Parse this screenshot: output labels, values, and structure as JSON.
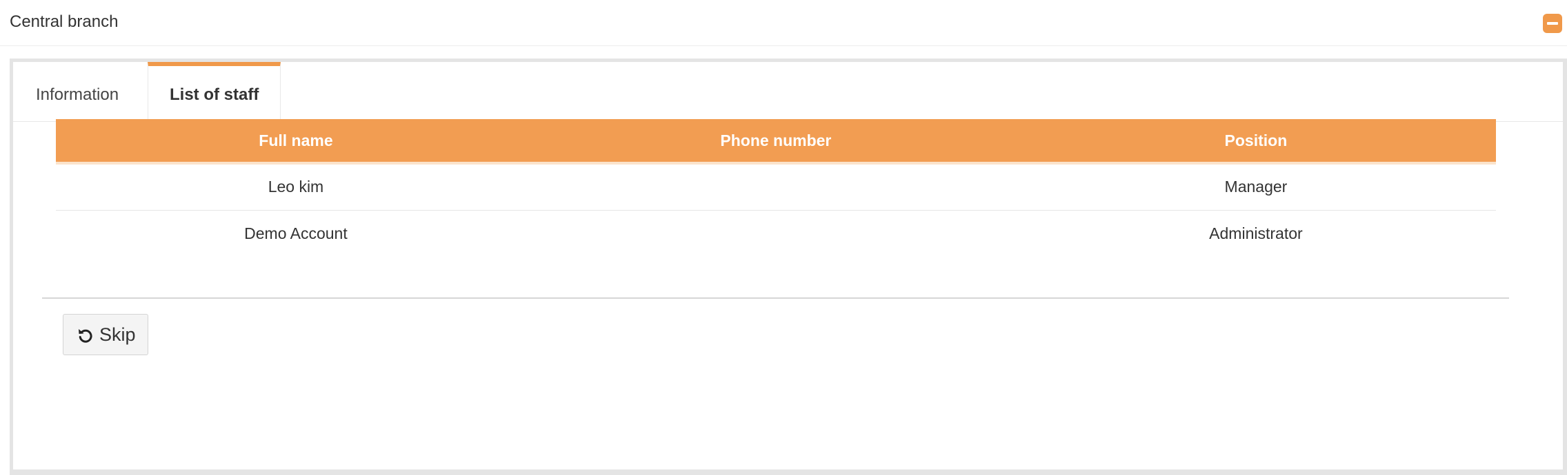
{
  "header": {
    "title": "Central branch",
    "collapse_icon": "minus-square-icon",
    "accent_color": "#f0994a"
  },
  "tabs": [
    {
      "label": "Information",
      "active": false
    },
    {
      "label": "List of staff",
      "active": true
    }
  ],
  "staff_table": {
    "columns": [
      "Full name",
      "Phone number",
      "Position"
    ],
    "rows": [
      {
        "full_name": "Leo kim",
        "phone_number": "",
        "position": "Manager"
      },
      {
        "full_name": "Demo Account",
        "phone_number": "",
        "position": "Administrator"
      }
    ],
    "header_color": "#f29d52"
  },
  "actions": {
    "skip_label": "Skip",
    "skip_icon": "undo-icon"
  }
}
